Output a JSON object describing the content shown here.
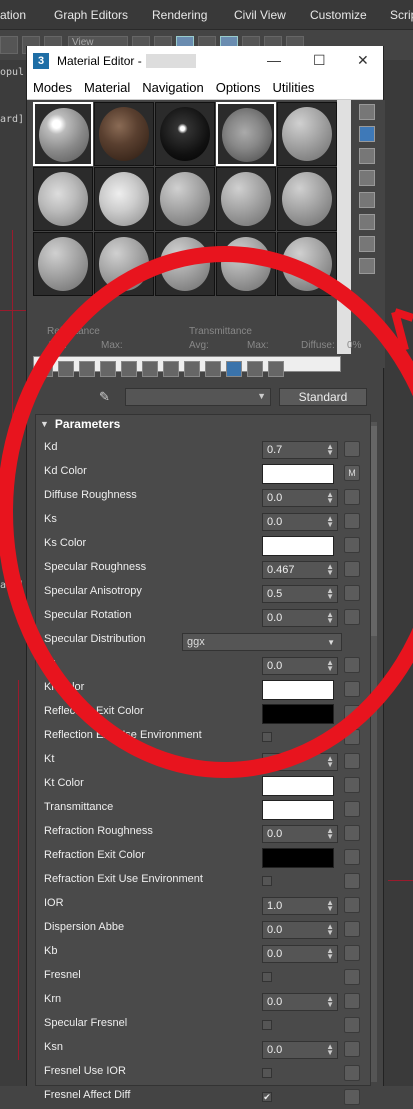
{
  "app_menu": [
    "ation",
    "Graph Editors",
    "Rendering",
    "Civil View",
    "Customize",
    "Scrip"
  ],
  "toolbar": {
    "view_select": "View"
  },
  "viewport_left": {
    "label1": "ard]",
    "label2": "ard]",
    "label3": "opul"
  },
  "window": {
    "icon": "3",
    "title": "Material Editor -",
    "min": "—",
    "max": "☐",
    "close": "✕"
  },
  "menu": [
    "Modes",
    "Material",
    "Navigation",
    "Options",
    "Utilities"
  ],
  "reflectance": {
    "refl_label": "Reflectance",
    "trans_label": "Transmittance",
    "avg1": "Avg:",
    "max1": "Max:",
    "avg2": "Avg:",
    "max2": "Max:",
    "diffuse": "Diffuse:",
    "pct": "0%"
  },
  "material_type": "Standard",
  "params_title": "Parameters",
  "params": [
    {
      "label": "Kd",
      "kind": "spin",
      "value": "0.7"
    },
    {
      "label": "Kd Color",
      "kind": "color",
      "color": "#ffffff",
      "map": "M"
    },
    {
      "label": "Diffuse Roughness",
      "kind": "spin",
      "value": "0.0"
    },
    {
      "label": "Ks",
      "kind": "spin",
      "value": "0.0"
    },
    {
      "label": "Ks Color",
      "kind": "color",
      "color": "#ffffff"
    },
    {
      "label": "Specular Roughness",
      "kind": "spin",
      "value": "0.467"
    },
    {
      "label": "Specular Anisotropy",
      "kind": "spin",
      "value": "0.5"
    },
    {
      "label": "Specular Rotation",
      "kind": "spin",
      "value": "0.0"
    },
    {
      "label": "Specular Distribution",
      "kind": "dropdown",
      "value": "ggx"
    },
    {
      "label": "Kr",
      "kind": "spin",
      "value": "0.0"
    },
    {
      "label": "Kr Color",
      "kind": "color",
      "color": "#ffffff"
    },
    {
      "label": "Reflection Exit Color",
      "kind": "color",
      "color": "#000000"
    },
    {
      "label": "Reflection Exit Use Environment",
      "kind": "check",
      "checked": ""
    },
    {
      "label": "Kt",
      "kind": "spin",
      "value": "0.0"
    },
    {
      "label": "Kt Color",
      "kind": "color",
      "color": "#ffffff"
    },
    {
      "label": "Transmittance",
      "kind": "color",
      "color": "#ffffff"
    },
    {
      "label": "Refraction Roughness",
      "kind": "spin",
      "value": "0.0"
    },
    {
      "label": "Refraction Exit Color",
      "kind": "color",
      "color": "#000000"
    },
    {
      "label": "Refraction Exit Use Environment",
      "kind": "check",
      "checked": ""
    },
    {
      "label": "IOR",
      "kind": "spin",
      "value": "1.0"
    },
    {
      "label": "Dispersion Abbe",
      "kind": "spin",
      "value": "0.0"
    },
    {
      "label": "Kb",
      "kind": "spin",
      "value": "0.0"
    },
    {
      "label": "Fresnel",
      "kind": "check",
      "checked": ""
    },
    {
      "label": "Krn",
      "kind": "spin",
      "value": "0.0"
    },
    {
      "label": "Specular Fresnel",
      "kind": "check",
      "checked": ""
    },
    {
      "label": "Ksn",
      "kind": "spin",
      "value": "0.0"
    },
    {
      "label": "Fresnel Use IOR",
      "kind": "check",
      "checked": ""
    },
    {
      "label": "Fresnel Affect Diff",
      "kind": "check",
      "checked": "✔"
    }
  ],
  "colors": {
    "annotation": "#e8141e",
    "accent": "#3a73ab"
  }
}
